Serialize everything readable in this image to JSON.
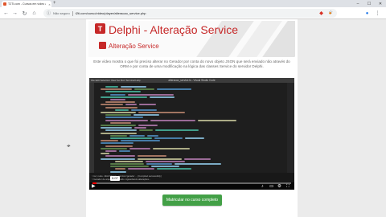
{
  "browser": {
    "tab_title": "T2Ti.com - Cursos em vídeo aulas",
    "tab_close": "×",
    "new_tab": "+",
    "window_controls": {
      "minimize": "–",
      "maximize": "☐",
      "close": "✕"
    },
    "nav": {
      "back": "←",
      "forward": "→",
      "reload": "↻",
      "home": "⌂"
    },
    "address": {
      "lock": "ⓘ",
      "security_label": "Não seguro",
      "url": "t2ti.com/curso/video/player/alteracao_service.php"
    },
    "star": "☆"
  },
  "page": {
    "logo_letter": "T",
    "title": "Delphi - Alteração Service",
    "subtitle": "Alteração Service",
    "description": "Este vídeo mostra o que foi preciso alterar no Gerador por conta do novo objeto JSON que será enviado não através do ORM e por conta de uma modificação na lógica das classes Service do servidor Delphi.",
    "cta_label": "Matricular no curso completo"
  },
  "video": {
    "ide_title": "alteracao_service.ts - Visual Studio Code",
    "ide_menu": "File Edit Selection View Go Run Terminal Help",
    "terminal_line1": "> tsc; node ./dist/index.js --service=gerador ... [Compiled successfully]",
    "terminal_line2": "> Gerador de arquivos concluído. Aguardando alterações...",
    "timestamp": "0:07",
    "progress": 0.02
  },
  "colors": {
    "brand_red": "#c62828",
    "cta_green": "#43a047",
    "progress_red": "#ff0000"
  }
}
